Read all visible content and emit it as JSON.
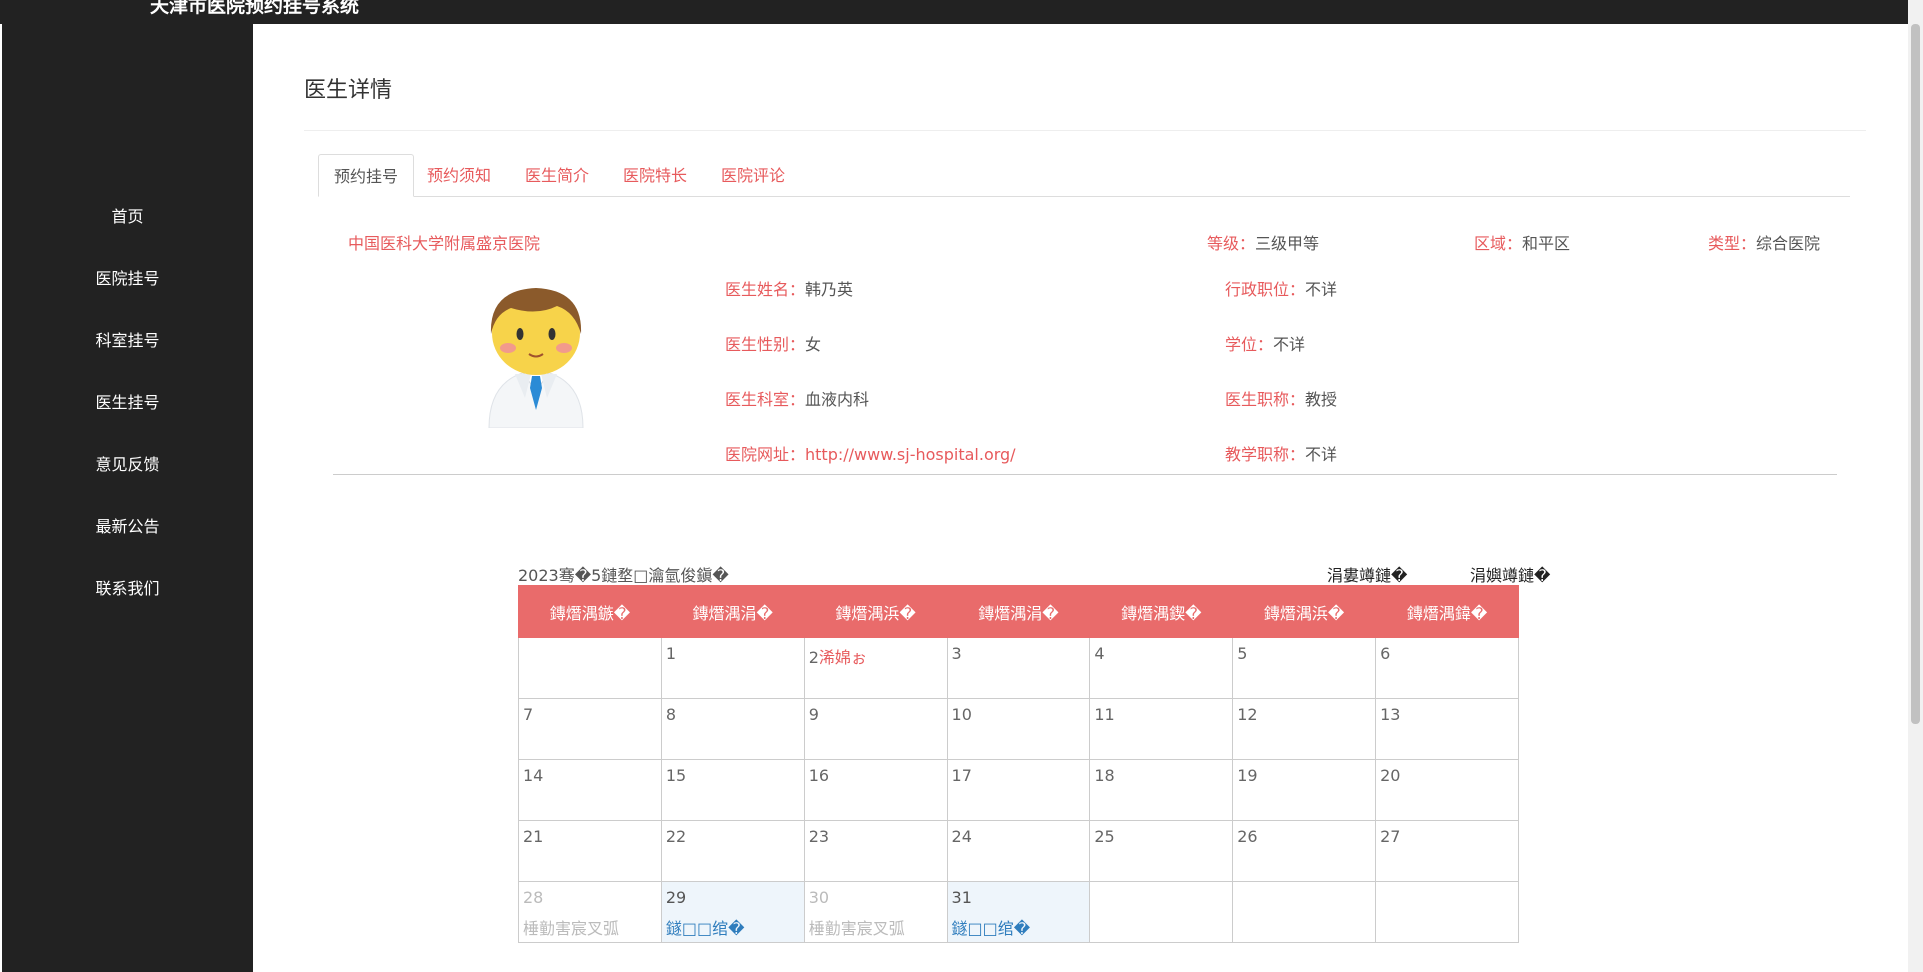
{
  "header": {
    "title": "天津市医院预约挂号系统"
  },
  "sidebar": {
    "items": [
      {
        "label": "首页"
      },
      {
        "label": "医院挂号"
      },
      {
        "label": "科室挂号"
      },
      {
        "label": "医生挂号"
      },
      {
        "label": "意见反馈"
      },
      {
        "label": "最新公告"
      },
      {
        "label": "联系我们"
      }
    ]
  },
  "page": {
    "title": "医生详情"
  },
  "tabs": [
    {
      "label": "预约挂号",
      "active": true
    },
    {
      "label": "预约须知"
    },
    {
      "label": "医生简介"
    },
    {
      "label": "医院特长"
    },
    {
      "label": "医院评论"
    }
  ],
  "hospital": {
    "name": "中国医科大学附属盛京医院",
    "level_label": "等级：",
    "level": "三级甲等",
    "area_label": "区域：",
    "area": "和平区",
    "type_label": "类型：",
    "type": "综合医院"
  },
  "doctor": {
    "name_label": "医生姓名：",
    "name": "韩乃英",
    "gender_label": "医生性别：",
    "gender": "女",
    "dept_label": "医生科室：",
    "dept": "血液内科",
    "site_label": "医院网址：",
    "site": "http://www.sj-hospital.org/",
    "admin_title_label": "行政职位：",
    "admin_title": "不详",
    "degree_label": "学位：",
    "degree": "不详",
    "prof_title_label": "医生职称：",
    "prof_title": "教授",
    "teach_title_label": "教学职称：",
    "teach_title": "不详",
    "avatar_icon": "doctor-avatar-icon"
  },
  "calendar": {
    "heading": "2023骞�5鏈堥□瀹氫俊鎭�",
    "prev_label": "涓婁竴鏈�",
    "next_label": "涓嬩竴鏈�",
    "weekdays": [
      "鏄熸湡鏃�",
      "鏄熸湡涓�",
      "鏄熸湡浜�",
      "鏄熸湡涓�",
      "鏄熸湡鍥�",
      "鏄熸湡浜�",
      "鏄熸湡鍏�"
    ],
    "weeks": [
      [
        {
          "day": ""
        },
        {
          "day": "1"
        },
        {
          "day": "2",
          "note": "浠婂ぉ",
          "style": "today"
        },
        {
          "day": "3"
        },
        {
          "day": "4"
        },
        {
          "day": "5"
        },
        {
          "day": "6"
        }
      ],
      [
        {
          "day": "7"
        },
        {
          "day": "8"
        },
        {
          "day": "9"
        },
        {
          "day": "10"
        },
        {
          "day": "11"
        },
        {
          "day": "12"
        },
        {
          "day": "13"
        }
      ],
      [
        {
          "day": "14"
        },
        {
          "day": "15"
        },
        {
          "day": "16"
        },
        {
          "day": "17"
        },
        {
          "day": "18"
        },
        {
          "day": "19"
        },
        {
          "day": "20"
        }
      ],
      [
        {
          "day": "21"
        },
        {
          "day": "22"
        },
        {
          "day": "23"
        },
        {
          "day": "24"
        },
        {
          "day": "25"
        },
        {
          "day": "26"
        },
        {
          "day": "27"
        }
      ],
      [
        {
          "day": "28",
          "note": "棰勭害宸叉弧",
          "style": "past"
        },
        {
          "day": "29",
          "note": "鐩□□绾�",
          "style": "avail"
        },
        {
          "day": "30",
          "note": "棰勭害宸叉弧",
          "style": "past"
        },
        {
          "day": "31",
          "note": "鐩□□绾�",
          "style": "avail"
        },
        {
          "day": ""
        },
        {
          "day": ""
        },
        {
          "day": ""
        }
      ]
    ]
  },
  "colors": {
    "accent": "#e75a5c",
    "header_bg": "#e96b6b",
    "sidebar_bg": "#222222",
    "avail_bg": "#eef5fb"
  }
}
